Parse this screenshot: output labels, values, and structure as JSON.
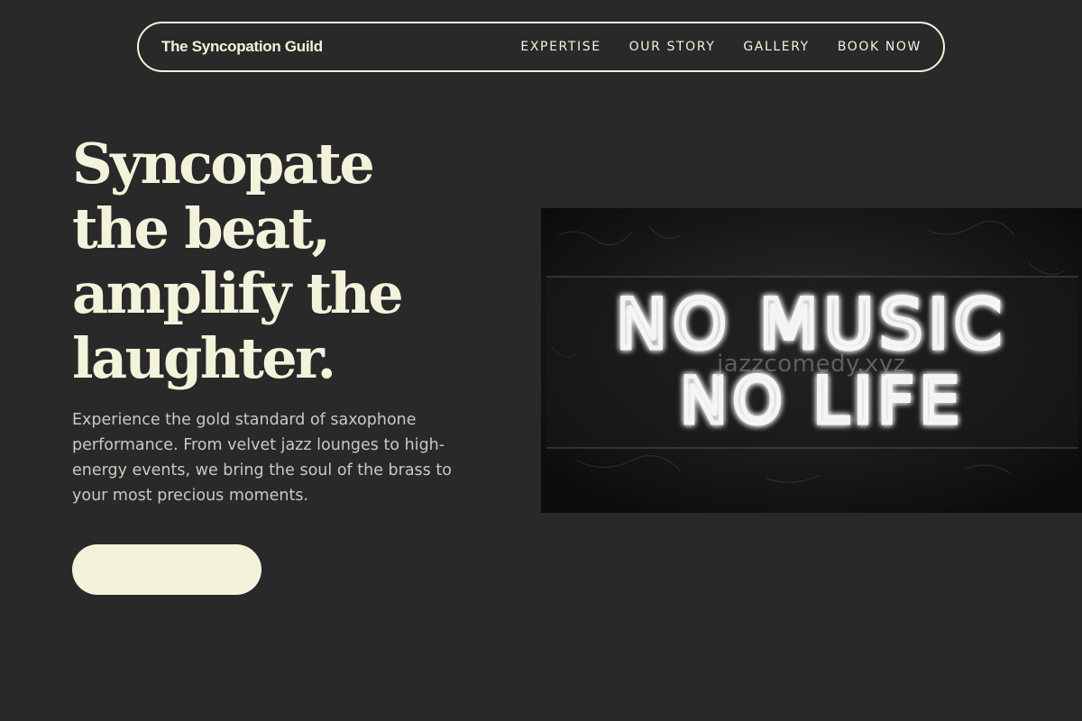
{
  "nav": {
    "brand": "The Syncopation Guild",
    "links": [
      {
        "label": "EXPERTISE"
      },
      {
        "label": "OUR STORY"
      },
      {
        "label": "GALLERY"
      },
      {
        "label": "BOOK NOW"
      }
    ]
  },
  "hero": {
    "headline_lines": [
      "Syncopate",
      "the beat,",
      "amplify the",
      "laughter."
    ],
    "lede": "Experience the gold standard of saxophone performance. From velvet jazz lounges to high-energy events, we bring the soul of the brass to your most precious moments.",
    "cta_label": ""
  },
  "image": {
    "sign_line_1": "NO MUSIC",
    "sign_line_2": "NO LIFE",
    "watermark": "jazzcomedy.xyz"
  },
  "colors": {
    "background": "#292929",
    "accent": "#f3f3dc",
    "body_text": "#c9c9c0"
  }
}
